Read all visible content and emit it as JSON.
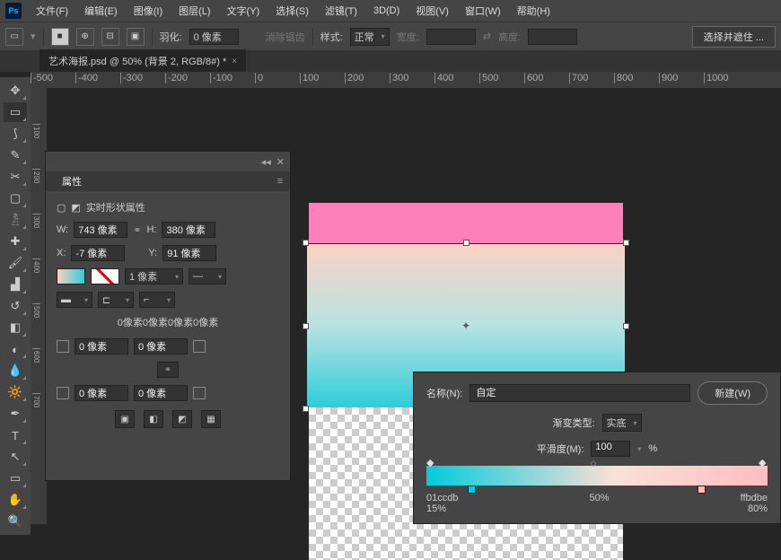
{
  "menu": {
    "items": [
      "文件(F)",
      "编辑(E)",
      "图像(I)",
      "图层(L)",
      "文字(Y)",
      "选择(S)",
      "滤镜(T)",
      "3D(D)",
      "视图(V)",
      "窗口(W)",
      "帮助(H)"
    ]
  },
  "options": {
    "feather_label": "羽化:",
    "feather_value": "0 像素",
    "antialias": "消除锯齿",
    "style_label": "样式:",
    "style_value": "正常",
    "width_label": "宽度:",
    "height_label": "高度:",
    "select_mask": "选择并遮住 ..."
  },
  "tab": {
    "title": "艺术海报.psd @ 50% (背景 2, RGB/8#) *"
  },
  "ruler_h": [
    "-500",
    "-400",
    "-300",
    "-200",
    "-100",
    "0",
    "100",
    "200",
    "300",
    "400",
    "500",
    "600",
    "700",
    "800",
    "900",
    "1000"
  ],
  "panel": {
    "title": "属性",
    "subtitle": "实时形状属性",
    "W_lbl": "W:",
    "W_val": "743 像素",
    "H_lbl": "H:",
    "H_val": "380 像素",
    "X_lbl": "X:",
    "X_val": "-7 像素",
    "Y_lbl": "Y:",
    "Y_val": "91 像素",
    "stroke_w": "1 像素",
    "corner_line": "0像素0像素0像素0像素",
    "c_val": "0 像素"
  },
  "gradient": {
    "name_lbl": "名称(N):",
    "name_val": "自定",
    "new_btn": "新建(W)",
    "type_lbl": "渐变类型:",
    "type_val": "实底",
    "smooth_lbl": "平滑度(M):",
    "smooth_val": "100",
    "pct": "%",
    "left_col": "01ccdb",
    "left_pct": "15%",
    "mid_pct": "50%",
    "right_col": "ffbdbe",
    "right_pct": "80%"
  }
}
